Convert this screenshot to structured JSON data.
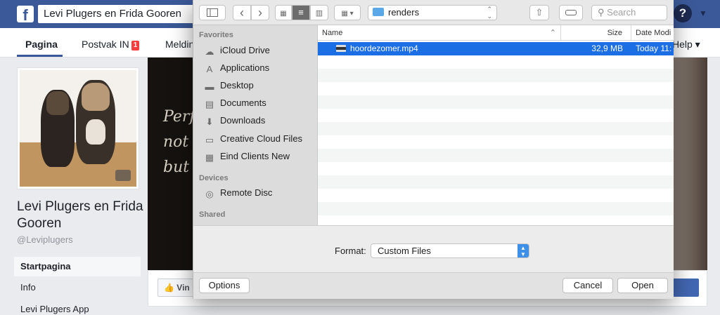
{
  "facebook": {
    "logo": "f",
    "search_value": "Levi Plugers en Frida Gooren",
    "help_icon": "?",
    "tabs": [
      {
        "label": "Pagina"
      },
      {
        "label": "Postvak IN",
        "badge": "1"
      },
      {
        "label": "Meldin"
      }
    ],
    "help_label": "Help",
    "page": {
      "name": "Levi Plugers en Frida Gooren",
      "handle": "@Leviplugers"
    },
    "sidebar_items": [
      "Startpagina",
      "Info",
      "Levi Plugers App"
    ],
    "cover_lines": [
      "Perf",
      "not n",
      "but i"
    ],
    "like_label": "Vin",
    "colors": {
      "brand": "#3b5998",
      "badge": "#fa3e3e",
      "action": "#4267b2"
    }
  },
  "dialog": {
    "toolbar": {
      "sidebar_toggle_icon": "sidebar-icon",
      "back_icon": "‹",
      "forward_icon": "›",
      "location": "renders",
      "search_placeholder": "Search"
    },
    "sidebar": {
      "sections": [
        {
          "header": "Favorites",
          "items": [
            {
              "label": "iCloud Drive",
              "icon": "☁"
            },
            {
              "label": "Applications",
              "icon": "A"
            },
            {
              "label": "Desktop",
              "icon": "▬"
            },
            {
              "label": "Documents",
              "icon": "▤"
            },
            {
              "label": "Downloads",
              "icon": "⬇"
            },
            {
              "label": "Creative Cloud Files",
              "icon": "▭"
            },
            {
              "label": "Eind Clients New",
              "icon": "▦"
            }
          ]
        },
        {
          "header": "Devices",
          "items": [
            {
              "label": "Remote Disc",
              "icon": "◎"
            }
          ]
        },
        {
          "header": "Shared",
          "items": []
        }
      ]
    },
    "columns": {
      "name": "Name",
      "size": "Size",
      "date": "Date Modi"
    },
    "files": [
      {
        "name": "hoordezomer.mp4",
        "size": "32,9 MB",
        "date": "Today 11:"
      }
    ],
    "format_label": "Format:",
    "format_value": "Custom Files",
    "buttons": {
      "options": "Options",
      "cancel": "Cancel",
      "open": "Open"
    },
    "colors": {
      "selection": "#1b6ee3",
      "select_accent": "#3d8fe8"
    }
  }
}
